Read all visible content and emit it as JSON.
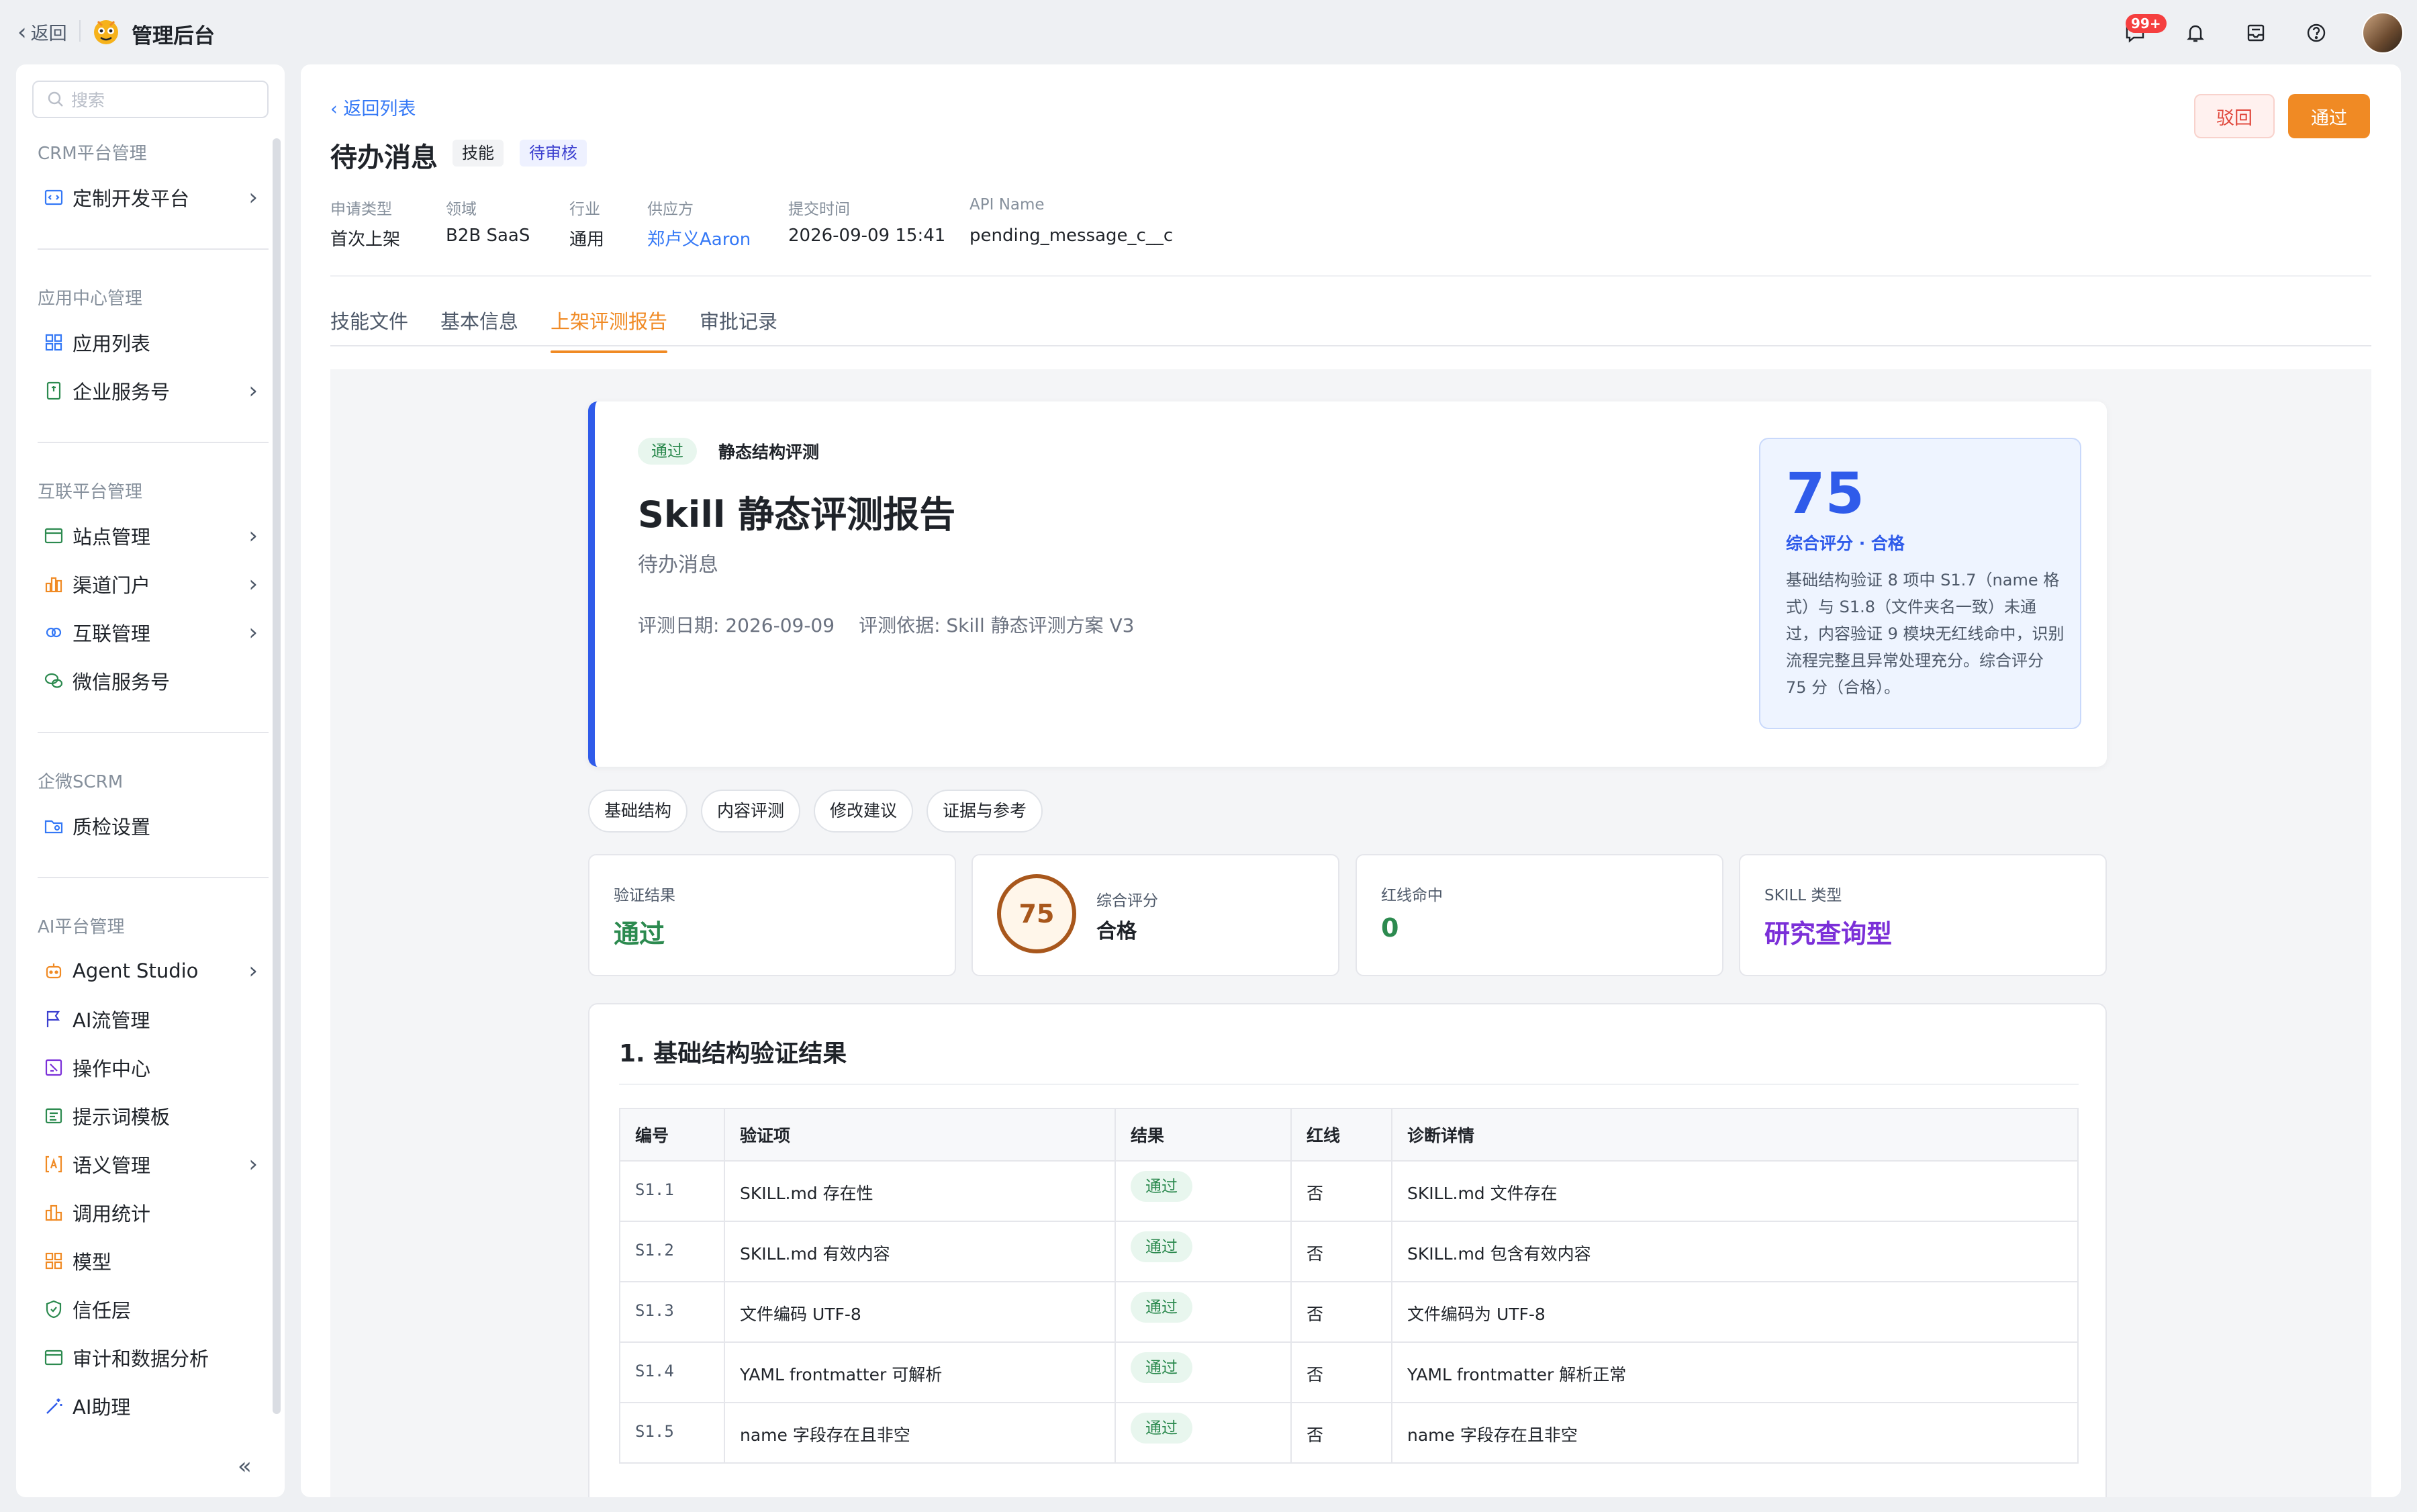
{
  "topbar": {
    "back_label": "返回",
    "app_title": "管理后台",
    "notif_count": "99+",
    "icons": [
      "message-icon",
      "bell-icon",
      "inbox-icon",
      "help-icon"
    ]
  },
  "sidebar": {
    "search_placeholder": "搜索",
    "sections": [
      {
        "title": "CRM平台管理",
        "items": [
          {
            "label": "定制开发平台",
            "icon": "code-icon",
            "has_arrow": true
          }
        ]
      },
      {
        "title": "应用中心管理",
        "items": [
          {
            "label": "应用列表",
            "icon": "grid-icon",
            "has_arrow": false
          },
          {
            "label": "企业服务号",
            "icon": "bookmark-icon",
            "has_arrow": true
          }
        ]
      },
      {
        "title": "互联平台管理",
        "items": [
          {
            "label": "站点管理",
            "icon": "window-icon",
            "has_arrow": true
          },
          {
            "label": "渠道门户",
            "icon": "chart-icon",
            "has_arrow": true
          },
          {
            "label": "互联管理",
            "icon": "link-icon",
            "has_arrow": true
          },
          {
            "label": "微信服务号",
            "icon": "wechat-icon",
            "has_arrow": false
          }
        ]
      },
      {
        "title": "企微SCRM",
        "items": [
          {
            "label": "质检设置",
            "icon": "folder-check-icon",
            "has_arrow": false
          }
        ]
      },
      {
        "title": "AI平台管理",
        "items": [
          {
            "label": "Agent Studio",
            "icon": "robot-icon",
            "has_arrow": true
          },
          {
            "label": "AI流管理",
            "icon": "flag-icon",
            "has_arrow": false
          },
          {
            "label": "操作中心",
            "icon": "operation-icon",
            "has_arrow": false
          },
          {
            "label": "提示词模板",
            "icon": "template-icon",
            "has_arrow": false
          },
          {
            "label": "语义管理",
            "icon": "semantic-icon",
            "has_arrow": true
          },
          {
            "label": "调用统计",
            "icon": "stats-icon",
            "has_arrow": false
          },
          {
            "label": "模型",
            "icon": "model-icon",
            "has_arrow": false
          },
          {
            "label": "信任层",
            "icon": "shield-icon",
            "has_arrow": false
          },
          {
            "label": "审计和数据分析",
            "icon": "audit-icon",
            "has_arrow": false
          },
          {
            "label": "AI助理",
            "icon": "magic-wand-icon",
            "has_arrow": false
          }
        ]
      }
    ]
  },
  "header": {
    "back_to_list": "‹ 返回列表",
    "title": "待办消息",
    "tag_type": "技能",
    "tag_status": "待审核",
    "reject_label": "驳回",
    "approve_label": "通过",
    "meta": [
      {
        "label": "申请类型",
        "value": "首次上架"
      },
      {
        "label": "领域",
        "value": "B2B SaaS"
      },
      {
        "label": "行业",
        "value": "通用"
      },
      {
        "label": "供应方",
        "value": "郑卢义Aaron"
      },
      {
        "label": "提交时间",
        "value": "2026-09-09 15:41"
      },
      {
        "label": "API Name",
        "value": "pending_message_c__c"
      }
    ]
  },
  "tabs": [
    "技能文件",
    "基本信息",
    "上架评测报告",
    "审批记录"
  ],
  "active_tab": "上架评测报告",
  "report": {
    "status_tag": "通过",
    "eval_type": "静态结构评测",
    "title": "Skill 静态评测报告",
    "subtitle": "待办消息",
    "date": "评测日期: 2026-09-09",
    "basis": "评测依据: Skill 静态评测方案 V3",
    "score": "75",
    "score_label": "综合评分 · 合格",
    "score_desc": "基础结构验证 8 项中 S1.7（name 格式）与 S1.8（文件夹名一致）未通过，内容验证 9 模块无红线命中，识别流程完整且异常处理充分。综合评分 75 分（合格）。",
    "pills": [
      "基础结构",
      "内容评测",
      "修改建议",
      "证据与参考"
    ],
    "stats": {
      "verify_label": "验证结果",
      "verify_value": "通过",
      "score_label": "综合评分",
      "score_value": "75",
      "score_grade": "合格",
      "redline_label": "红线命中",
      "redline_value": "0",
      "skill_type_label": "SKILL 类型",
      "skill_type_value": "研究查询型"
    },
    "colors": {
      "pass_green": "#2c8a4f",
      "score_brown": "#a8571c",
      "type_purple": "#7b2fd8",
      "accent_blue": "#2f5bea"
    },
    "section_title": "1. 基础结构验证结果",
    "table": {
      "headers": [
        "编号",
        "验证项",
        "结果",
        "红线",
        "诊断详情"
      ],
      "rows": [
        {
          "id": "S1.1",
          "item": "SKILL.md 存在性",
          "result": "通过",
          "redline": "否",
          "detail": "SKILL.md 文件存在"
        },
        {
          "id": "S1.2",
          "item": "SKILL.md 有效内容",
          "result": "通过",
          "redline": "否",
          "detail": "SKILL.md 包含有效内容"
        },
        {
          "id": "S1.3",
          "item": "文件编码 UTF-8",
          "result": "通过",
          "redline": "否",
          "detail": "文件编码为 UTF-8"
        },
        {
          "id": "S1.4",
          "item": "YAML frontmatter 可解析",
          "result": "通过",
          "redline": "否",
          "detail": "YAML frontmatter 解析正常"
        },
        {
          "id": "S1.5",
          "item": "name 字段存在且非空",
          "result": "通过",
          "redline": "否",
          "detail": "name 字段存在且非空"
        }
      ]
    }
  }
}
